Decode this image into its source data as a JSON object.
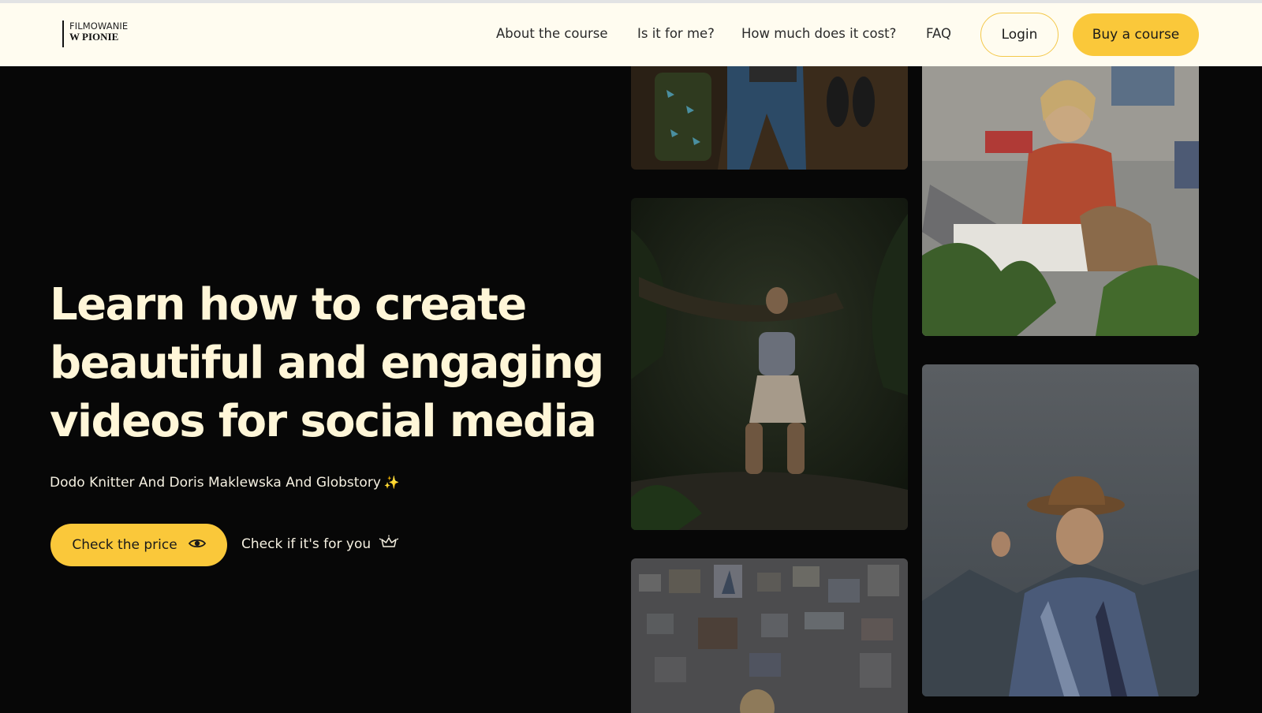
{
  "logo": {
    "line1": "FILMOWANIE",
    "line2": "W PIONIE"
  },
  "nav": {
    "about": "About the course",
    "for_me": "Is it for me?",
    "cost": "How much does it cost?",
    "faq": "FAQ",
    "login": "Login",
    "buy": "Buy a course"
  },
  "hero": {
    "headline_lines": [
      "Learn how to create",
      "beautiful and engaging",
      "videos for social media"
    ],
    "authors": "Dodo Knitter And Doris Maklewska And Globstory",
    "authors_emoji": "✨",
    "check_price": "Check the price",
    "check_fit": "Check if it's for you"
  },
  "colors": {
    "accent_yellow": "#fac83a",
    "nav_background": "#fffcf0",
    "hero_background": "#070707",
    "headline_text": "#fff6d8"
  },
  "icons": {
    "check_price_icon": "eye-icon",
    "check_fit_icon": "crown-icon",
    "authors_icon": "sparkles-icon"
  }
}
